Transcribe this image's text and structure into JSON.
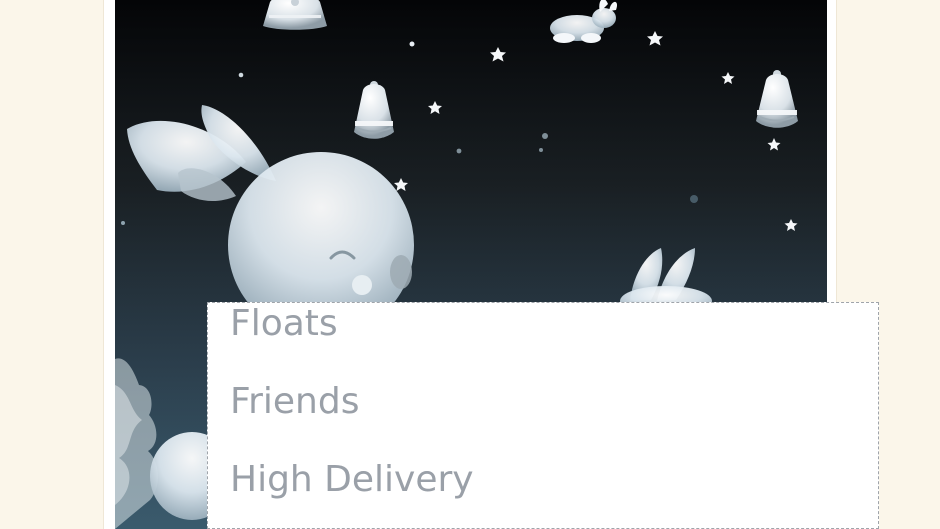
{
  "menu": {
    "items": [
      {
        "label": "Floats"
      },
      {
        "label": "Friends"
      },
      {
        "label": "High Delivery"
      }
    ]
  },
  "colors": {
    "page_background": "#fbf6ea",
    "night_sky_dark": "#040507",
    "night_sky_blue": "#183d52",
    "menu_text": "#9aa0a8",
    "menu_border": "#9fa4aa"
  },
  "image": {
    "content_icons": [
      "bell-icon",
      "rabbit-icon",
      "star-icon",
      "bunny-head-icon",
      "winged-creature-icon"
    ]
  }
}
